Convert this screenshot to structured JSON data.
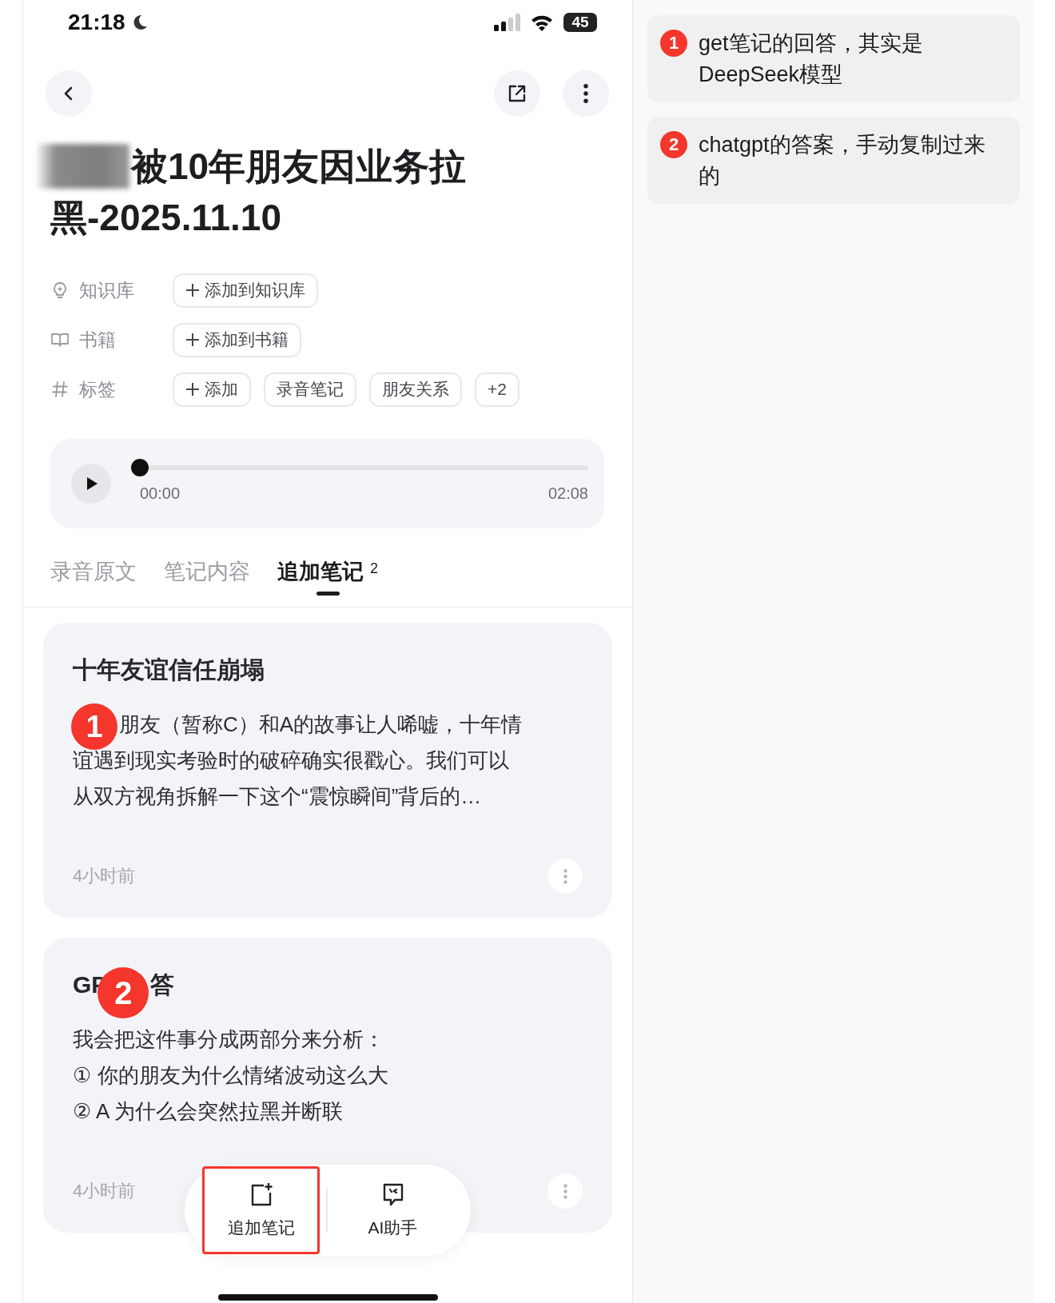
{
  "status_bar": {
    "time": "21:18",
    "battery": "45"
  },
  "note": {
    "title": "被10年朋友因业务拉黑-2025.11.10",
    "title_redacted": true,
    "meta": [
      {
        "kind": "knowledge",
        "label": "知识库",
        "chips": [
          {
            "kind": "add",
            "text": "添加到知识库"
          }
        ]
      },
      {
        "kind": "book",
        "label": "书籍",
        "chips": [
          {
            "kind": "add",
            "text": "添加到书籍"
          }
        ]
      },
      {
        "kind": "tag",
        "label": "标签",
        "chips": [
          {
            "kind": "add",
            "text": "添加"
          },
          {
            "kind": "tag",
            "text": "录音笔记"
          },
          {
            "kind": "tag",
            "text": "朋友关系"
          },
          {
            "kind": "tag",
            "text": "+2"
          }
        ]
      }
    ]
  },
  "player": {
    "level": 0,
    "current": "00:00",
    "duration": "02:08"
  },
  "tabs": [
    {
      "label": "录音原文",
      "selected": false
    },
    {
      "label": "笔记内容",
      "selected": false
    },
    {
      "label": "追加笔记",
      "count": "2",
      "selected": true
    }
  ],
  "cards": [
    {
      "title_parts": [
        "十年友谊信任崩塌"
      ],
      "body_badge": "1",
      "body": [
        "朋友（暂称C）和A的故事让人唏嘘，十年情",
        "谊遇到现实考验时的破碎确实很戳心。我们可以",
        "从双方视角拆解一下这个“震惊瞬间”背后的…"
      ],
      "time": "4小时前"
    },
    {
      "title_parts": [
        "GP",
        "答"
      ],
      "title_badge": "2",
      "body": [
        "我会把这件事分成两部分来分析：",
        "① 你的朋友为什么情绪波动这么大",
        "② A 为什么会突然拉黑并断联"
      ],
      "time": "4小时前"
    }
  ],
  "action_bar": [
    {
      "kind": "add-note",
      "label": "追加笔记",
      "highlighted": true
    },
    {
      "kind": "assistant",
      "label": "AI助手",
      "highlighted": false
    }
  ],
  "annotations": [
    {
      "label": "1",
      "text": "get笔记的回答，其实是DeepSeek模型"
    },
    {
      "label": "2",
      "text": "chatgpt的答案，手动复制过来的"
    }
  ]
}
